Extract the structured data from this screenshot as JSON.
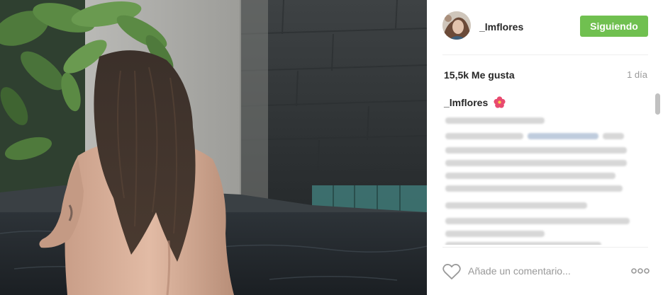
{
  "post": {
    "username": "_lmflores",
    "follow_label": "Siguiendo",
    "likes": "15,5k Me gusta",
    "age": "1 día",
    "caption": {
      "username": "_lmflores",
      "emoji": "hibiscus-icon"
    },
    "comment_placeholder": "Añade un comentario...",
    "icons": [
      "avatar",
      "heart-icon",
      "more-options-icon",
      "hibiscus-icon"
    ],
    "colors": {
      "follow_button": "#70c050",
      "text": "#262626",
      "muted": "#999999",
      "divider": "#efefef"
    }
  }
}
